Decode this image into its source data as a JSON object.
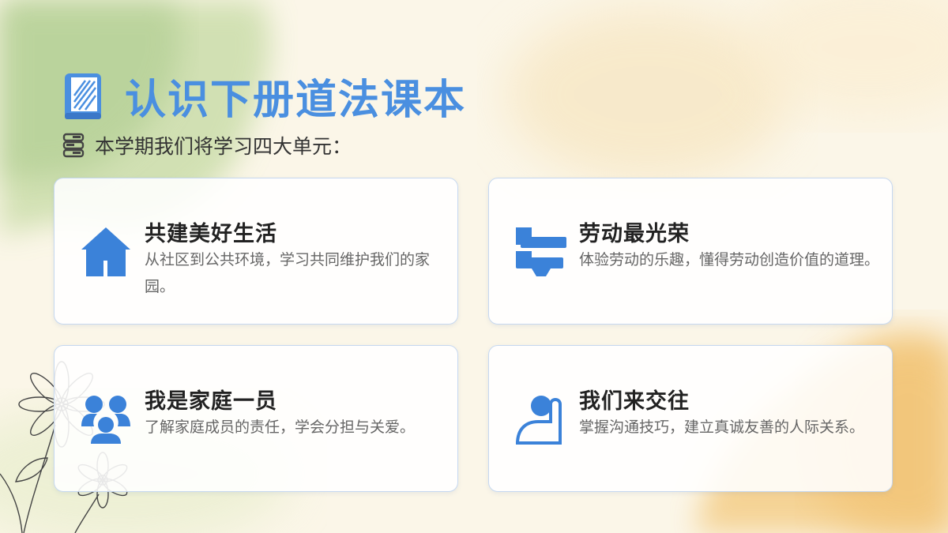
{
  "title": "认识下册道法课本",
  "subtitle": "本学期我们将学习四大单元：",
  "colors": {
    "accent": "#4a8fe0",
    "icon": "#3b82d9"
  },
  "units": [
    {
      "icon": "house-icon",
      "title": "共建美好生活",
      "desc": "从社区到公共环境，学习共同维护我们的家园。"
    },
    {
      "icon": "tools-icon",
      "title": "劳动最光荣",
      "desc": "体验劳动的乐趣，懂得劳动创造价值的道理。"
    },
    {
      "icon": "family-icon",
      "title": "我是家庭一员",
      "desc": "了解家庭成员的责任，学会分担与关爱。"
    },
    {
      "icon": "communication-icon",
      "title": "我们来交往",
      "desc": "掌握沟通技巧，建立真诚友善的人际关系。"
    }
  ]
}
